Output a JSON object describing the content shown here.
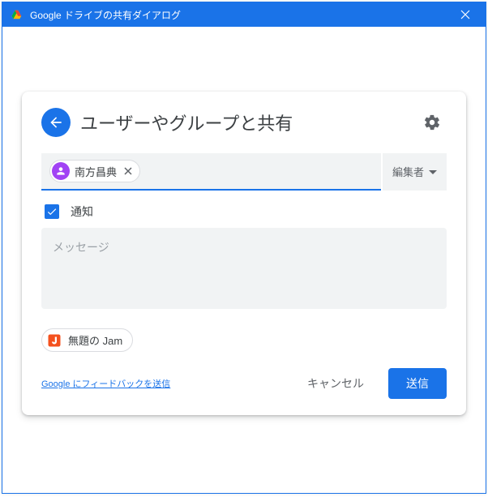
{
  "window": {
    "title": "Google ドライブの共有ダイアログ"
  },
  "header": {
    "title": "ユーザーやグループと共有"
  },
  "input": {
    "chip": {
      "name": "南方昌典"
    },
    "role": "編集者"
  },
  "notify": {
    "label": "通知",
    "checked": true
  },
  "message": {
    "placeholder": "メッセージ"
  },
  "attachment": {
    "name": "無題の Jam"
  },
  "footer": {
    "feedback": "Google にフィードバックを送信",
    "cancel": "キャンセル",
    "send": "送信"
  },
  "icons": {
    "back": "back-arrow-icon",
    "gear": "gear-icon",
    "close": "close-icon",
    "person": "person-icon",
    "check": "check-icon",
    "jam": "jamboard-icon",
    "drive": "drive-icon",
    "caret": "caret-down-icon"
  },
  "colors": {
    "primary": "#1a73e8",
    "chipAvatar": "#a142f4",
    "attachIcon": "#f4511e"
  }
}
